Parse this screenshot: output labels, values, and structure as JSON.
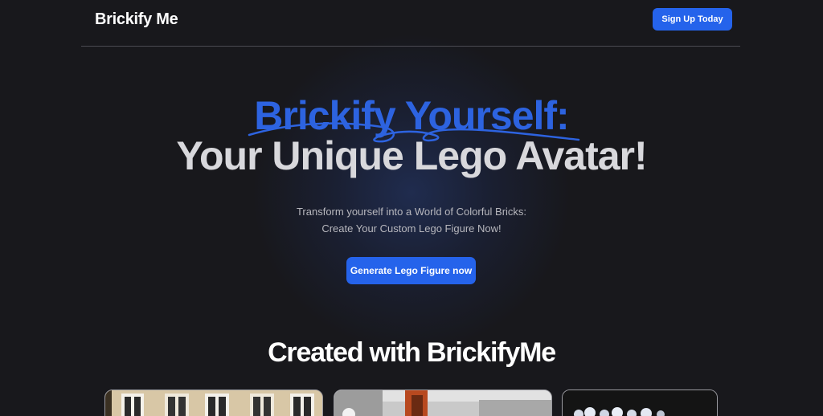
{
  "nav": {
    "brand": "Brickify Me",
    "signup_label": "Sign Up Today"
  },
  "hero": {
    "title_line1": "Brickify Yourself:",
    "title_line2": "Your Unique Lego Avatar!",
    "subtitle_line1": "Transform yourself into a World of Colorful Bricks:",
    "subtitle_line2": "Create Your Custom Lego Figure Now!",
    "cta_label": "Generate Lego Figure now"
  },
  "gallery": {
    "title": "Created with BrickifyMe"
  },
  "colors": {
    "accent": "#2563eb",
    "background": "#18181c"
  }
}
